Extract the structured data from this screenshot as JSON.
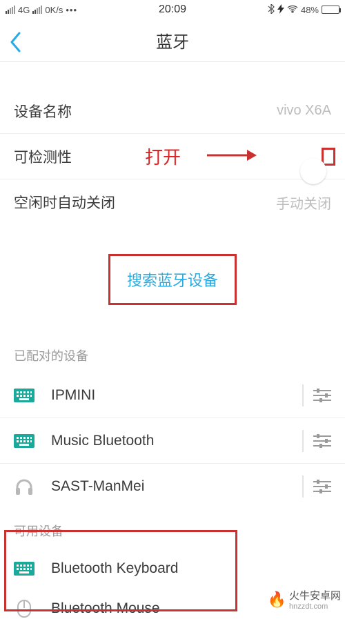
{
  "status": {
    "network": "4G",
    "speed": "0K/s",
    "time": "20:09",
    "battery_percent": "48%"
  },
  "nav": {
    "title": "蓝牙"
  },
  "rows": {
    "device_name_label": "设备名称",
    "device_name_value": "vivo X6A",
    "discoverable_label": "可检测性",
    "idle_off_label": "空闲时自动关闭",
    "idle_off_value": "手动关闭"
  },
  "annotation": {
    "open_text": "打开"
  },
  "search_label": "搜索蓝牙设备",
  "sections": {
    "paired": "已配对的设备",
    "available": "可用设备"
  },
  "paired_devices": [
    {
      "name": "IPMINI",
      "type": "keyboard"
    },
    {
      "name": "Music Bluetooth",
      "type": "keyboard"
    },
    {
      "name": "SAST-ManMei",
      "type": "headphone"
    }
  ],
  "available_devices": [
    {
      "name": "Bluetooth  Keyboard",
      "type": "keyboard"
    },
    {
      "name": "Bluetooth Mouse",
      "type": "mouse"
    }
  ],
  "watermark": {
    "name": "火牛安卓网",
    "url": "hnzzdt.com"
  }
}
